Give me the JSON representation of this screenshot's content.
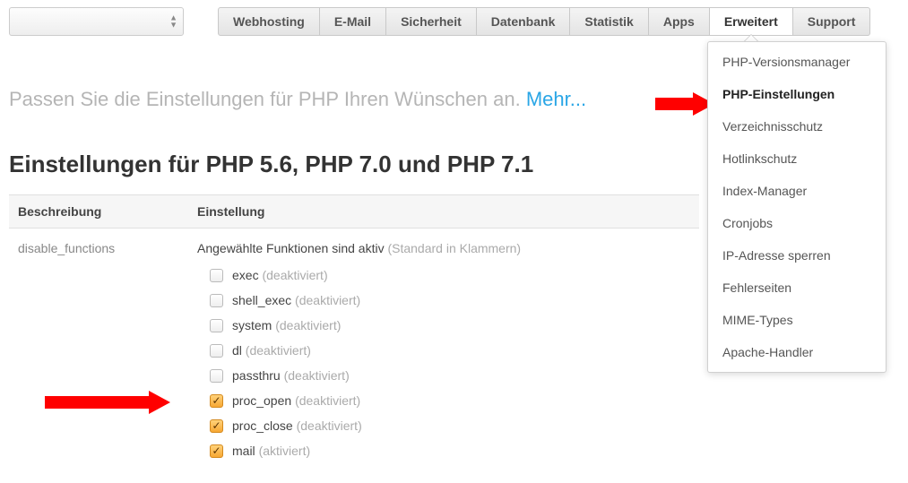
{
  "tabs": [
    "Webhosting",
    "E-Mail",
    "Sicherheit",
    "Datenbank",
    "Statistik",
    "Apps",
    "Erweitert",
    "Support"
  ],
  "tabs_active_index": 6,
  "dropdown": {
    "items": [
      "PHP-Versionsmanager",
      "PHP-Einstellungen",
      "Verzeichnisschutz",
      "Hotlinkschutz",
      "Index-Manager",
      "Cronjobs",
      "IP-Adresse sperren",
      "Fehlerseiten",
      "MIME-Types",
      "Apache-Handler"
    ],
    "active_index": 1
  },
  "intro": {
    "text": "Passen Sie die Einstellungen für PHP Ihren Wünschen an.",
    "more": "Mehr..."
  },
  "heading": "Einstellungen für PHP 5.6, PHP 7.0 und PHP 7.1",
  "table": {
    "col_desc": "Beschreibung",
    "col_setting": "Einstellung",
    "row_key": "disable_functions",
    "func_intro": "Angewählte Funktionen sind aktiv",
    "func_intro_muted": "(Standard in Klammern)",
    "def_deact": "(deaktiviert)",
    "def_act": "(aktiviert)",
    "funcs": [
      {
        "name": "exec",
        "checked": false,
        "default": "deact"
      },
      {
        "name": "shell_exec",
        "checked": false,
        "default": "deact"
      },
      {
        "name": "system",
        "checked": false,
        "default": "deact"
      },
      {
        "name": "dl",
        "checked": false,
        "default": "deact"
      },
      {
        "name": "passthru",
        "checked": false,
        "default": "deact"
      },
      {
        "name": "proc_open",
        "checked": true,
        "default": "deact"
      },
      {
        "name": "proc_close",
        "checked": true,
        "default": "deact"
      },
      {
        "name": "mail",
        "checked": true,
        "default": "act"
      }
    ]
  }
}
